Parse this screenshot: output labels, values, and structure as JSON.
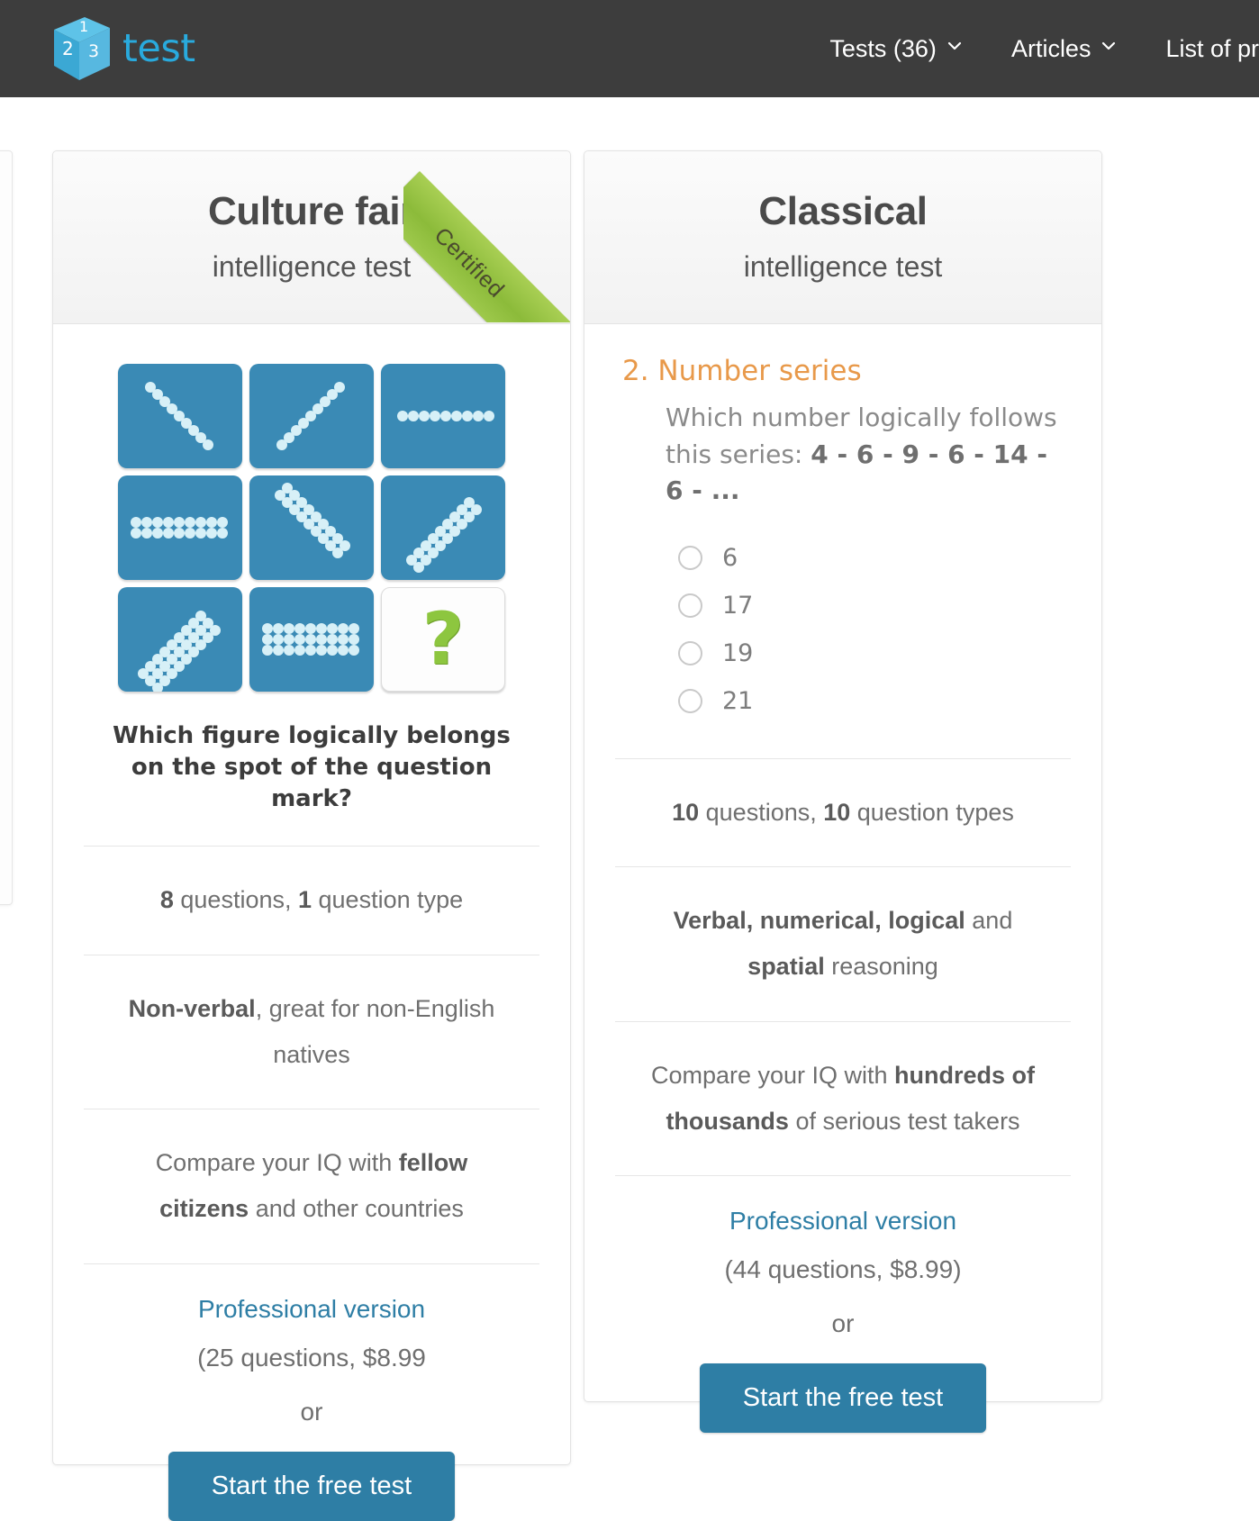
{
  "header": {
    "logo_text": "test",
    "logo_cube_numbers": [
      "1",
      "2",
      "3"
    ],
    "nav": [
      {
        "label": "Tests (36)",
        "has_caret": true,
        "icon": "chevron-down-icon"
      },
      {
        "label": "Articles",
        "has_caret": true,
        "icon": "chevron-down-icon"
      },
      {
        "label": "List of pr",
        "has_caret": false,
        "icon": ""
      }
    ],
    "background_color": "#3d3d3d",
    "logo_color": "#29aadd"
  },
  "cards": [
    {
      "id": "culture-fair",
      "title": "Culture fair",
      "subtitle": "intelligence test",
      "ribbon": {
        "label": "Certified",
        "color": "#8cbb3a"
      },
      "puzzle": {
        "question": "Which figure logically belongs on the spot of the question mark?",
        "answer_cell_glyph": "?",
        "answer_cell_color": "#8dc63f",
        "cell_color": "#3a8ab5",
        "cells": [
          {
            "pattern": "diagonal-down",
            "rows": 1,
            "dots": 10
          },
          {
            "pattern": "diagonal-up",
            "rows": 1,
            "dots": 10
          },
          {
            "pattern": "horizontal",
            "rows": 1,
            "dots": 10
          },
          {
            "pattern": "horizontal",
            "rows": 2,
            "dots": 10
          },
          {
            "pattern": "diagonal-down",
            "rows": 2,
            "dots": 10
          },
          {
            "pattern": "diagonal-up",
            "rows": 2,
            "dots": 10
          },
          {
            "pattern": "diagonal-up",
            "rows": 3,
            "dots": 10
          },
          {
            "pattern": "horizontal",
            "rows": 3,
            "dots": 10
          },
          {
            "pattern": "answer",
            "rows": 0,
            "dots": 0
          }
        ]
      },
      "features": [
        {
          "html": "<b>8</b> questions, <b>1</b> question type"
        },
        {
          "html": "<b>Non-verbal</b>, great for non-English natives"
        },
        {
          "html": "Compare your IQ with <b>fellow citizens</b> and other countries"
        }
      ],
      "cta": {
        "pro_link": "Professional version",
        "pro_price": "(25 questions, $8.99",
        "or_word": "or",
        "button_label": "Start the free test",
        "button_color": "#2e7ea5"
      }
    },
    {
      "id": "classical",
      "title": "Classical",
      "subtitle": "intelligence test",
      "question": {
        "number_title": "2. Number series",
        "prompt_lead": "Which number logically follows this series:",
        "series": "4 - 6 - 9 - 6 - 14 - 6 - ...",
        "options": [
          "6",
          "17",
          "19",
          "21"
        ],
        "title_color": "#e8994a"
      },
      "features": [
        {
          "html": "<b>10</b> questions, <b>10</b> question types"
        },
        {
          "html": "<b>Verbal, numerical, logical</b> and <b>spatial</b> reasoning"
        },
        {
          "html": "Compare your IQ with <b>hundreds of thousands</b> of serious test takers"
        }
      ],
      "cta": {
        "pro_link": "Professional version",
        "pro_price": "(44 questions, $8.99)",
        "or_word": "or",
        "button_label": "Start the free test",
        "button_color": "#2e7ea5"
      }
    }
  ]
}
